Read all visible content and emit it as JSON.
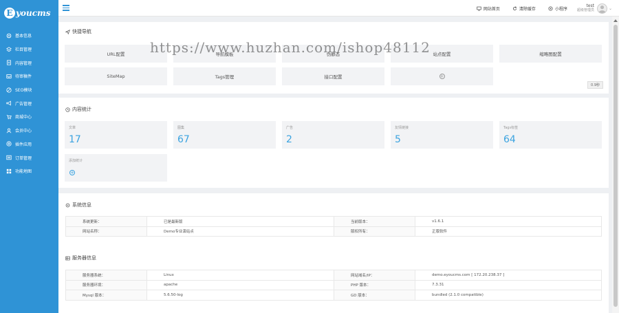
{
  "brand": {
    "logo_letter": "E",
    "logo_text": "youcms"
  },
  "sidebar": {
    "items": [
      {
        "label": "基本信息",
        "icon": "gear-icon"
      },
      {
        "label": "栏目管理",
        "icon": "layers-icon"
      },
      {
        "label": "内容管理",
        "icon": "document-icon"
      },
      {
        "label": "待审稿件",
        "icon": "inbox-icon"
      },
      {
        "label": "SEO模块",
        "icon": "seo-icon"
      },
      {
        "label": "广告管理",
        "icon": "bullhorn-icon"
      },
      {
        "label": "商城中心",
        "icon": "cart-icon"
      },
      {
        "label": "会员中心",
        "icon": "user-icon"
      },
      {
        "label": "插件应用",
        "icon": "plugin-icon"
      },
      {
        "label": "订单管理",
        "icon": "order-icon"
      },
      {
        "label": "功能地图",
        "icon": "grid-icon"
      }
    ]
  },
  "topbar": {
    "links": [
      {
        "label": "网站首页",
        "icon": "monitor-icon"
      },
      {
        "label": "清除缓存",
        "icon": "refresh-icon"
      },
      {
        "label": "小程序",
        "icon": "miniapp-icon"
      }
    ],
    "user": {
      "name": "test",
      "role": "超级管理员"
    }
  },
  "quick_nav": {
    "title": "快捷导航",
    "buttons": [
      "URL配置",
      "导航模板",
      "伪静态",
      "站点配置",
      "缩略图配置",
      "SiteMap",
      "Tags管理",
      "接口配置"
    ],
    "page_badge": "0.9秒"
  },
  "content_stats": {
    "title": "内容统计",
    "items": [
      {
        "label": "文章",
        "value": "17"
      },
      {
        "label": "图集",
        "value": "67"
      },
      {
        "label": "广告",
        "value": "2"
      },
      {
        "label": "友情链接",
        "value": "5"
      },
      {
        "label": "Tags标签",
        "value": "64"
      }
    ],
    "add_label": "添加统计"
  },
  "system_info": {
    "title": "系统信息",
    "rows": [
      [
        "系统更新：",
        "已是最新版",
        "当前版本：",
        "v1.6.1"
      ],
      [
        "网站名称：",
        "Demo专业演站点",
        "版权所有：",
        "正版软件"
      ]
    ]
  },
  "server_info": {
    "title": "服务器信息",
    "rows": [
      [
        "服务器系统：",
        "Linux",
        "网站域名/IP：",
        "demo.eyoucms.com [ 172.20.238.37 ]"
      ],
      [
        "服务器环境：",
        "apache",
        "PHP 版本：",
        "7.3.31"
      ],
      [
        "Mysql 版本：",
        "5.6.50-log",
        "GD 版本：",
        "bundled (2.1.0 compatible)"
      ]
    ]
  },
  "watermark": "https://www.huzhan.com/ishop48112",
  "colors": {
    "sidebar": "#2f93d6",
    "accent": "#3ba3e0",
    "panel_bg": "#f2f3f5"
  }
}
